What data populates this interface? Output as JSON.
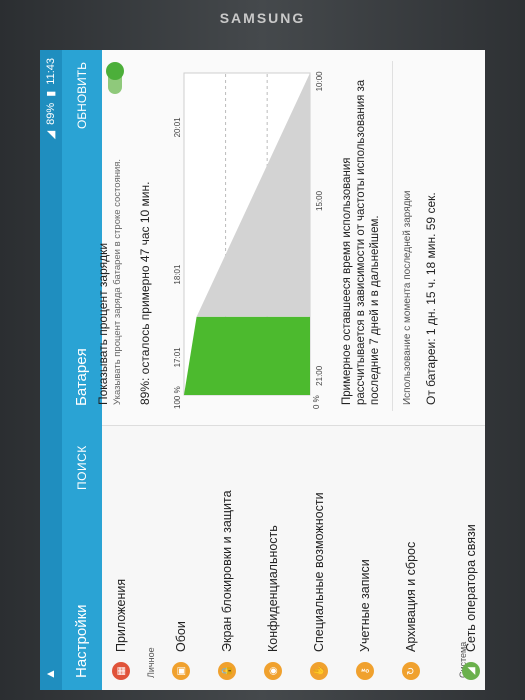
{
  "bezel": {
    "brand": "SAMSUNG"
  },
  "status_bar": {
    "battery": "89%",
    "time": "11:43"
  },
  "app_bar": {
    "nav_title": "Настройки",
    "search": "ПОИСК",
    "detail_title": "Батарея",
    "refresh": "ОБНОВИТЬ"
  },
  "sidebar": {
    "top_item": {
      "label": "Приложения",
      "icon": "apps-icon",
      "color": "#e0533a"
    },
    "section_personal": "Личное",
    "items": [
      {
        "label": "Обои",
        "icon": "wallpaper-icon",
        "color": "#f0a12e"
      },
      {
        "label": "Экран блокировки и защита",
        "icon": "lock-icon",
        "color": "#f0a12e"
      },
      {
        "label": "Конфиденциальность",
        "icon": "privacy-icon",
        "color": "#f0a12e"
      },
      {
        "label": "Специальные возможности",
        "icon": "accessibility-icon",
        "color": "#f0a12e"
      },
      {
        "label": "Учетные записи",
        "icon": "key-icon",
        "color": "#f0a12e"
      },
      {
        "label": "Архивация и сброс",
        "icon": "backup-icon",
        "color": "#f0a12e"
      }
    ],
    "section_system": "Система",
    "bottom_item": {
      "label": "Сеть оператора связи",
      "icon": "network-icon",
      "color": "#6ab04c"
    }
  },
  "detail": {
    "show_percent_title": "Показывать процент зарядки",
    "show_percent_subtitle": "Указывать процент заряда батареи в строке состояния.",
    "show_percent_on": true,
    "remaining": "89%: осталось примерно 47 час 10 мин.",
    "estimate_note": "Примерное оставшееся время использования рассчитывается в зависимости от частоты использования за последние 7 дней и в дальнейшем.",
    "since_charge_label": "Использование с момента последней зарядки",
    "from_battery": "От батареи: 1 дн. 15 ч. 18 мин. 59 сек."
  },
  "chart_data": {
    "type": "area",
    "y_ticks": [
      "100 %",
      "0 %"
    ],
    "x_ticks": [
      "17:01",
      "18:01",
      "20:01",
      "21:00",
      "15:00",
      "10:00"
    ],
    "series": [
      {
        "values": [
          [
            0,
            100
          ],
          [
            17,
            90
          ]
        ],
        "color": "#4cba2e"
      },
      {
        "values": [
          [
            17,
            90
          ],
          [
            70,
            0
          ]
        ],
        "color": "#d3d3d3"
      }
    ],
    "current_value": 89
  }
}
